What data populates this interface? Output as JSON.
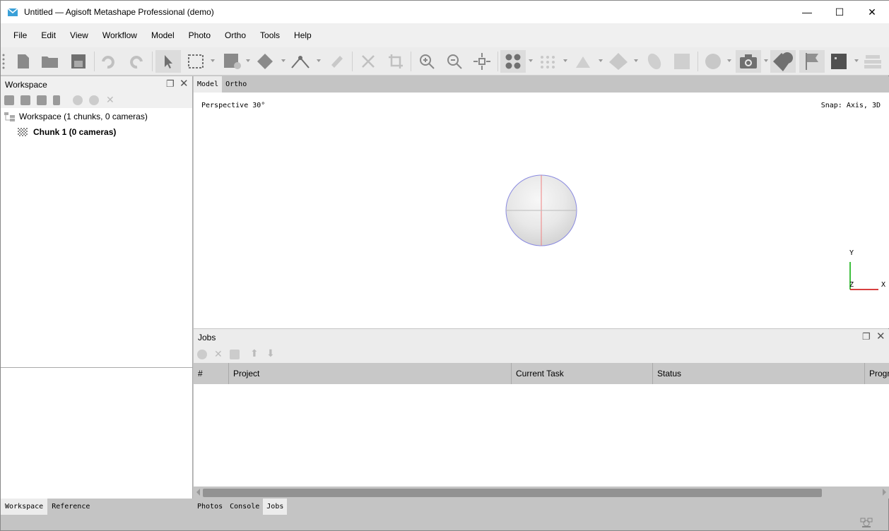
{
  "window": {
    "title": "Untitled — Agisoft Metashape Professional (demo)",
    "minimize": "—",
    "maximize": "☐",
    "close": "✕"
  },
  "menu": [
    "File",
    "Edit",
    "View",
    "Workflow",
    "Model",
    "Photo",
    "Ortho",
    "Tools",
    "Help"
  ],
  "workspace": {
    "title": "Workspace",
    "root": "Workspace (1 chunks, 0 cameras)",
    "chunk": "Chunk 1 (0 cameras)"
  },
  "viewport": {
    "tabs": [
      "Model",
      "Ortho"
    ],
    "projection": "Perspective 30°",
    "snap": "Snap: Axis, 3D",
    "axes": {
      "y": "Y",
      "x": "X",
      "z": "Z"
    }
  },
  "jobs": {
    "title": "Jobs",
    "columns": [
      "#",
      "Project",
      "Current Task",
      "Status",
      "Progr"
    ]
  },
  "left_tabs": [
    "Workspace",
    "Reference"
  ],
  "bottom_tabs": [
    "Photos",
    "Console",
    "Jobs"
  ],
  "colors": {
    "accent": "#2196c8",
    "axis_x": "#cc0000",
    "axis_y": "#00aa00"
  }
}
